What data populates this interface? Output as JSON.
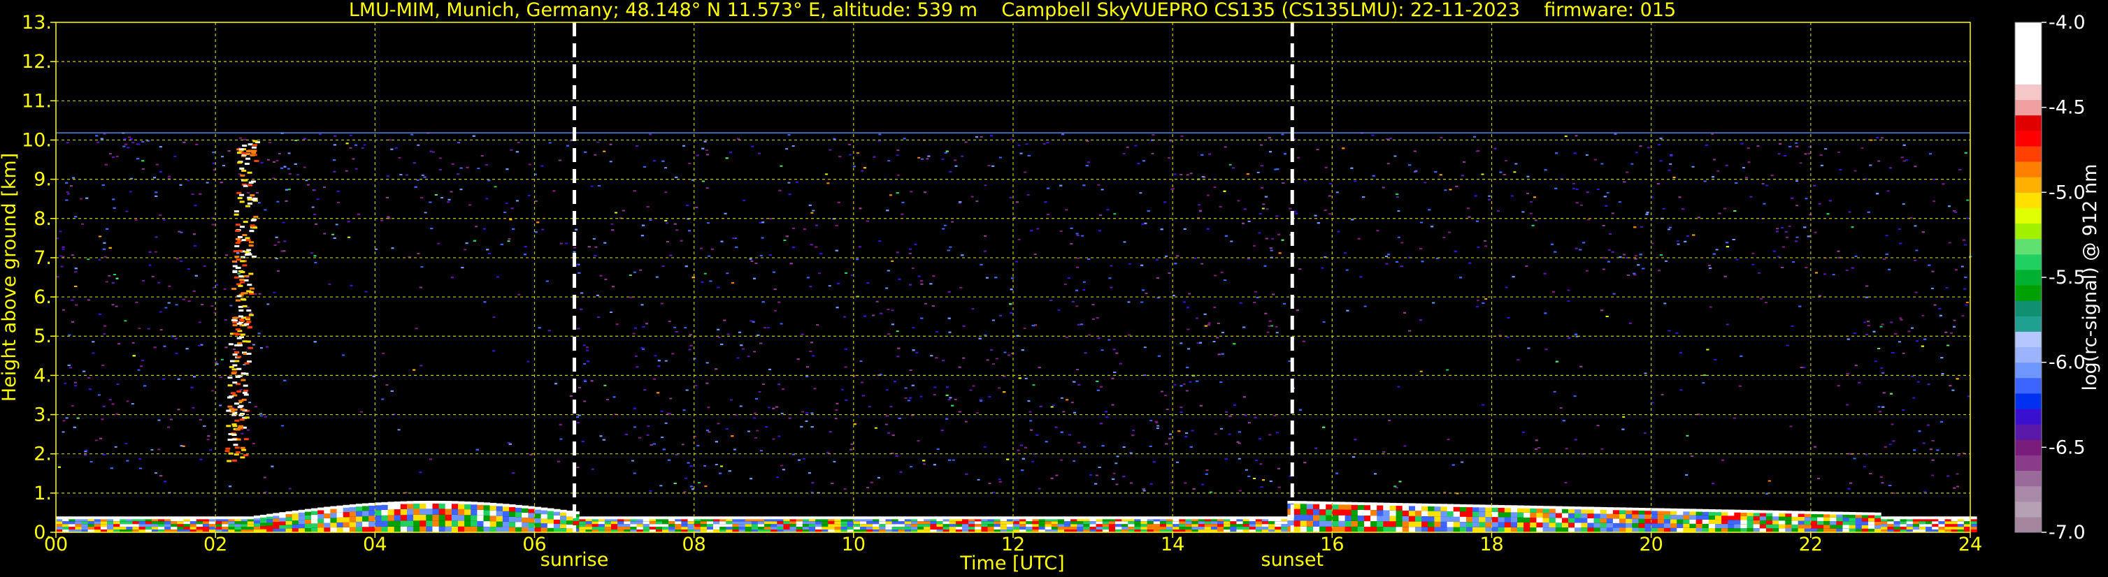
{
  "chart_data": {
    "type": "heatmap",
    "title": "LMU-MIM, Munich, Germany; 48.148° N 11.573° E, altitude: 539 m    Campbell SkyVUEPRO CS135 (CS135LMU): 22-11-2023    firmware: 015",
    "xlabel": "Time [UTC]",
    "ylabel": "Height above ground [km]",
    "xlim": [
      0,
      24
    ],
    "ylim": [
      0,
      13
    ],
    "x_ticks": [
      0,
      2,
      4,
      6,
      8,
      10,
      12,
      14,
      16,
      18,
      20,
      22,
      24
    ],
    "x_tick_labels": [
      "00",
      "02",
      "04",
      "06",
      "08",
      "10",
      "12",
      "14",
      "16",
      "18",
      "20",
      "22",
      "24"
    ],
    "y_ticks": [
      0,
      1,
      2,
      3,
      4,
      5,
      6,
      7,
      8,
      9,
      10,
      11,
      12,
      13
    ],
    "y_tick_labels": [
      "0.",
      "1.",
      "2.",
      "3.",
      "4.",
      "5.",
      "6.",
      "7.",
      "8.",
      "9.",
      "10.",
      "11.",
      "12.",
      "13."
    ],
    "grid": true,
    "markers": [
      {
        "label": "sunrise",
        "x": 6.5
      },
      {
        "label": "sunset",
        "x": 15.5
      }
    ],
    "colorbar": {
      "label": "log(rc-signal) @ 912 nm",
      "range": [
        -7.0,
        -4.0
      ],
      "tick_values": [
        -4.0,
        -4.5,
        -5.0,
        -5.5,
        -6.0,
        -6.5,
        -7.0
      ],
      "tick_labels": [
        "-4.0",
        "-4.5",
        "-5.0",
        "-5.5",
        "-6.0",
        "-6.5",
        "-7.0"
      ],
      "colors": [
        "#a4879f",
        "#b6a0b4",
        "#a88aa8",
        "#9a6a9a",
        "#8a3c8a",
        "#7a1c7a",
        "#5a18a8",
        "#3a10d0",
        "#0030f0",
        "#3c64ff",
        "#6e96ff",
        "#9cb4ff",
        "#b4c8ff",
        "#20a090",
        "#109070",
        "#00a000",
        "#00b030",
        "#20d060",
        "#60e070",
        "#a0f000",
        "#e0ff00",
        "#ffe000",
        "#ffb000",
        "#ff8000",
        "#ff4000",
        "#ff0000",
        "#e00000",
        "#f0a0a0",
        "#f4c8c8",
        "#ffffff",
        "#ffffff",
        "#ffffff",
        "#ffffff"
      ]
    },
    "data_top_km": 10.2
  }
}
